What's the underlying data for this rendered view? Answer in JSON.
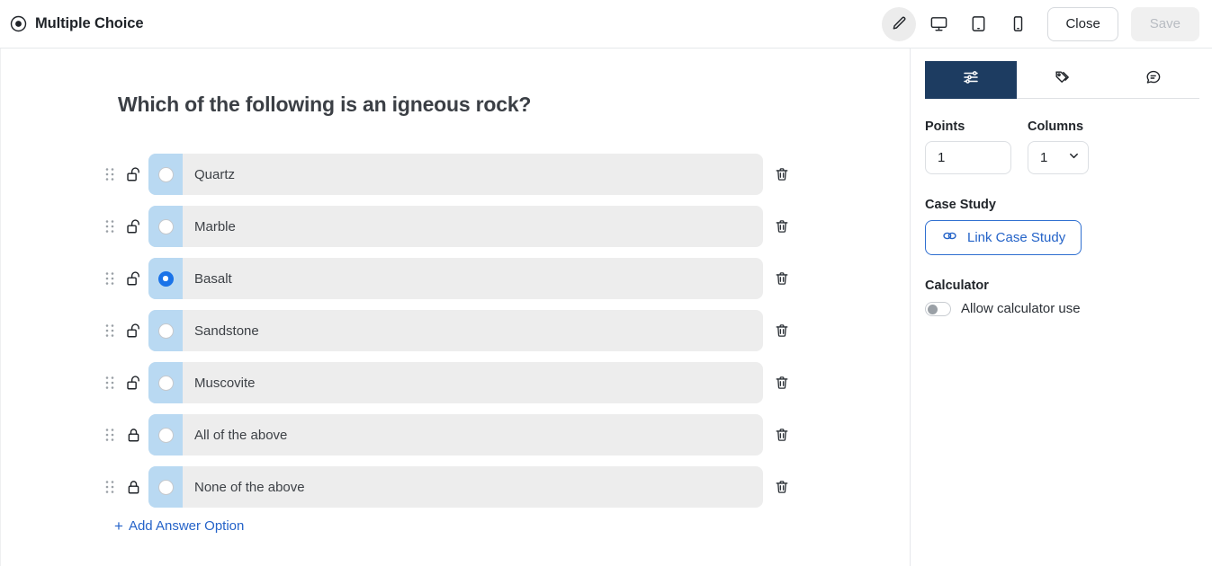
{
  "header": {
    "title": "Multiple Choice",
    "title_icon": "radio-selected-icon",
    "tools": [
      {
        "name": "edit-pencil",
        "icon": "pencil-icon",
        "active": true
      },
      {
        "name": "desktop-preview",
        "icon": "desktop-icon",
        "active": false
      },
      {
        "name": "tablet-preview",
        "icon": "tablet-icon",
        "active": false
      },
      {
        "name": "mobile-preview",
        "icon": "mobile-icon",
        "active": false
      }
    ],
    "close_label": "Close",
    "save_label": "Save",
    "save_disabled": true
  },
  "main": {
    "question": "Which of the following is an igneous rock?",
    "options": [
      {
        "text": "Quartz",
        "selected": false,
        "locked": false
      },
      {
        "text": "Marble",
        "selected": false,
        "locked": false
      },
      {
        "text": "Basalt",
        "selected": true,
        "locked": false
      },
      {
        "text": "Sandstone",
        "selected": false,
        "locked": false
      },
      {
        "text": "Muscovite",
        "selected": false,
        "locked": false
      },
      {
        "text": "All of the above",
        "selected": false,
        "locked": true
      },
      {
        "text": "None of the above",
        "selected": false,
        "locked": true
      }
    ],
    "add_option_label": "Add Answer Option",
    "add_option_glyph": "+"
  },
  "panel": {
    "tabs": [
      {
        "name": "settings-tab",
        "icon": "sliders-icon",
        "active": true
      },
      {
        "name": "tags-tab",
        "icon": "tag-icon",
        "active": false
      },
      {
        "name": "comments-tab",
        "icon": "comment-icon",
        "active": false
      }
    ],
    "points": {
      "label": "Points",
      "value": "1"
    },
    "columns": {
      "label": "Columns",
      "value": "1"
    },
    "case_study": {
      "label": "Case Study",
      "button_label": "Link Case Study",
      "icon": "link-icon"
    },
    "calculator": {
      "label": "Calculator",
      "toggle_label": "Allow calculator use",
      "enabled": false
    }
  },
  "colors": {
    "accent_blue": "#1a73e8",
    "link_blue": "#2463c8",
    "tab_active": "#1d3c61",
    "radio_zone": "#b9d9f2",
    "row_bg": "#ededed"
  }
}
